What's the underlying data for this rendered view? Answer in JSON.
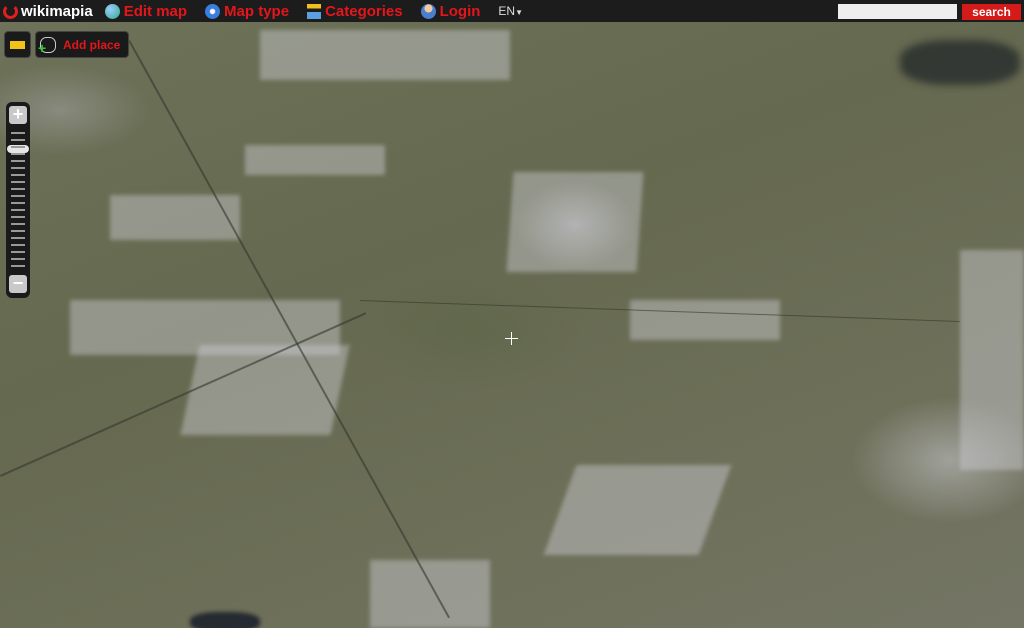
{
  "topbar": {
    "logo": "wikimapia",
    "nav": [
      {
        "label": "Edit map",
        "icon": "globe-pencil-icon"
      },
      {
        "label": "Map type",
        "icon": "compass-icon"
      },
      {
        "label": "Categories",
        "icon": "tree-list-icon"
      },
      {
        "label": "Login",
        "icon": "user-icon"
      }
    ],
    "language": "EN",
    "search_placeholder": "",
    "search_button": "search"
  },
  "tools": {
    "ruler": "ruler-icon",
    "add_place": "Add place"
  },
  "zoom": {
    "in": "+",
    "out": "−",
    "level_fraction": 0.9
  },
  "colors": {
    "accent": "#e4161b",
    "bar": "#1c1c1c"
  }
}
